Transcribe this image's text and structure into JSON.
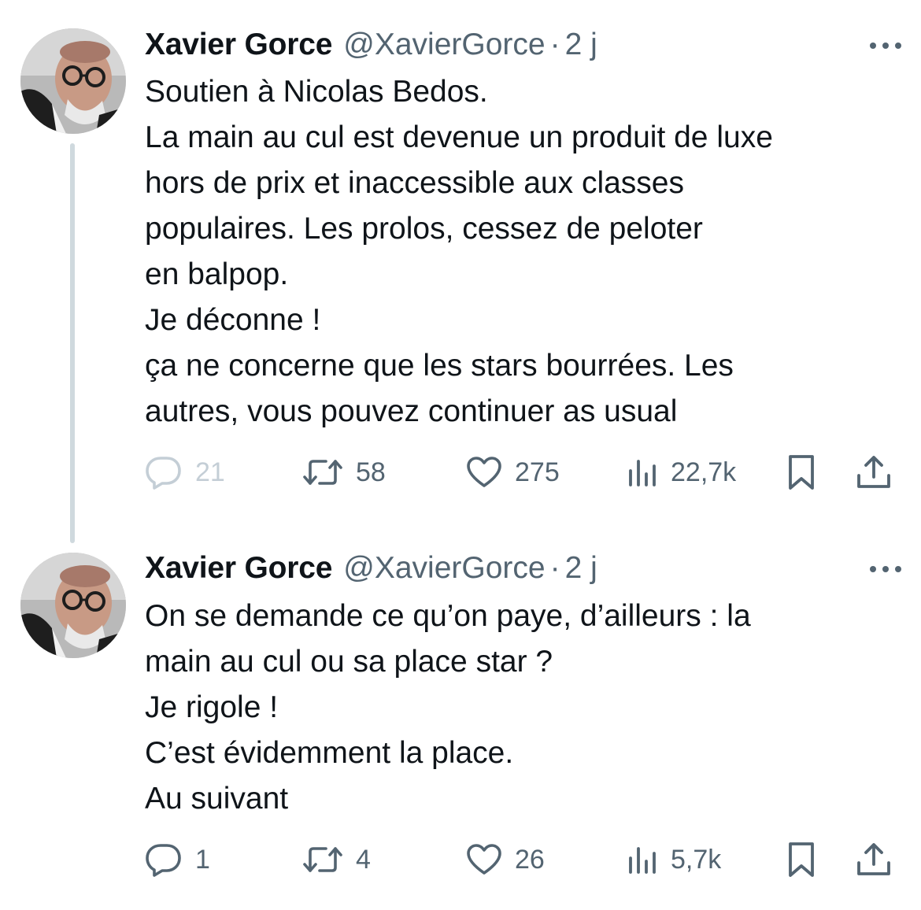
{
  "tweets": [
    {
      "author_name": "Xavier Gorce",
      "author_handle": "@XavierGorce",
      "separator": "·",
      "time": "2 j",
      "text_lines": [
        "Soutien à Nicolas Bedos.",
        "La main au cul est devenue un produit de luxe",
        "hors de prix et inaccessible aux classes",
        "populaires. Les prolos, cessez de peloter",
        "en balpop.",
        "Je déconne !",
        "ça ne concerne que les stars bourrées. Les",
        "autres, vous pouvez continuer as usual"
      ],
      "replies": "21",
      "retweets": "58",
      "likes": "275",
      "views": "22,7k",
      "icons": [
        "avatar",
        "more-icon",
        "reply-icon",
        "retweet-icon",
        "like-icon",
        "views-icon",
        "bookmark-icon",
        "share-icon"
      ]
    },
    {
      "author_name": "Xavier Gorce",
      "author_handle": "@XavierGorce",
      "separator": "·",
      "time": "2 j",
      "text_lines": [
        "On se demande ce qu’on paye, d’ailleurs : la",
        "main au cul ou sa place star ?",
        "Je rigole !",
        "C’est évidemment la place.",
        "Au suivant"
      ],
      "replies": "1",
      "retweets": "4",
      "likes": "26",
      "views": "5,7k",
      "icons": [
        "avatar",
        "more-icon",
        "reply-icon",
        "retweet-icon",
        "like-icon",
        "views-icon",
        "bookmark-icon",
        "share-icon"
      ]
    }
  ],
  "colors": {
    "text": "#0f1419",
    "secondary": "#536471",
    "muted_icon": "#c4ced6",
    "thread_line": "#cfd9de",
    "background": "#ffffff"
  }
}
